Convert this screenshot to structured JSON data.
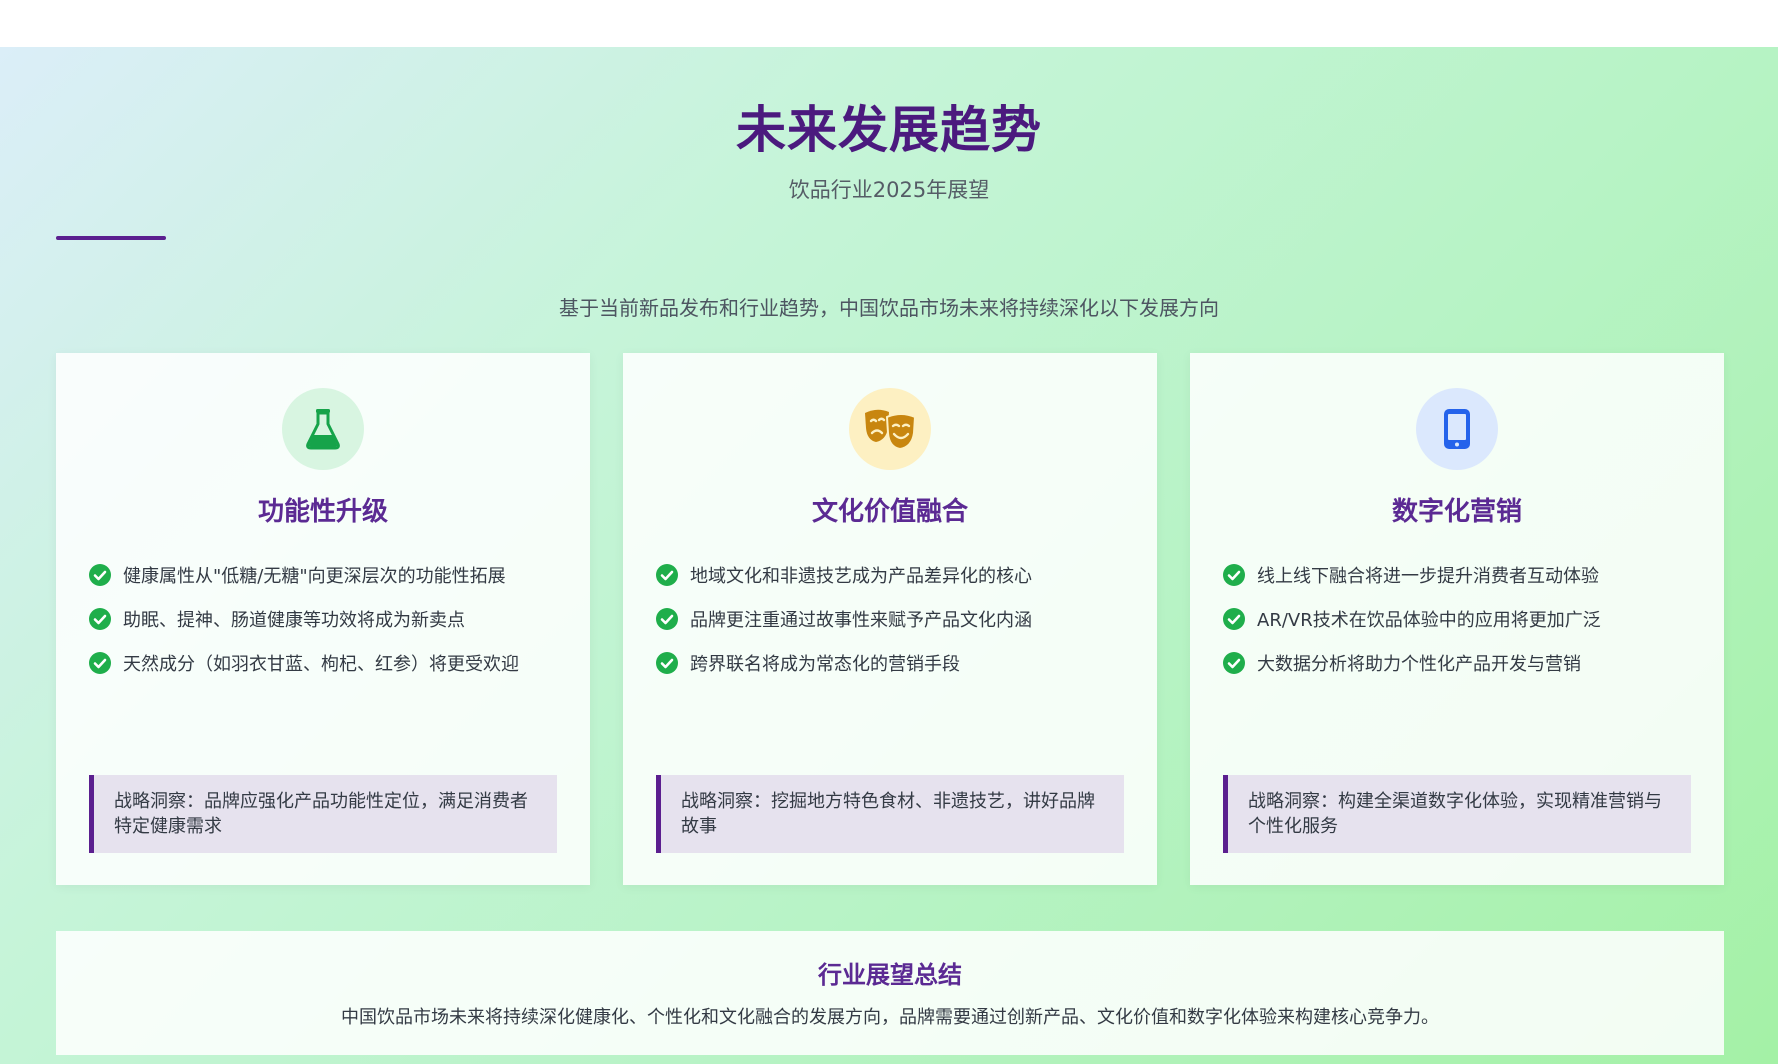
{
  "header": {
    "title": "未来发展趋势",
    "subtitle": "饮品行业2025年展望",
    "intro": "基于当前新品发布和行业趋势，中国饮品市场未来将持续深化以下发展方向"
  },
  "cards": [
    {
      "icon": "flask-icon",
      "icon_color": "#16a34a",
      "title": "功能性升级",
      "items": [
        "健康属性从\"低糖/无糖\"向更深层次的功能性拓展",
        "助眠、提神、肠道健康等功效将成为新卖点",
        "天然成分（如羽衣甘蓝、枸杞、红参）将更受欢迎"
      ],
      "insight": "战略洞察：品牌应强化产品功能性定位，满足消费者特定健康需求"
    },
    {
      "icon": "theater-masks-icon",
      "icon_color": "#c8860f",
      "title": "文化价值融合",
      "items": [
        "地域文化和非遗技艺成为产品差异化的核心",
        "品牌更注重通过故事性来赋予产品文化内涵",
        "跨界联名将成为常态化的营销手段"
      ],
      "insight": "战略洞察：挖掘地方特色食材、非遗技艺，讲好品牌故事"
    },
    {
      "icon": "mobile-phone-icon",
      "icon_color": "#2563eb",
      "title": "数字化营销",
      "items": [
        "线上线下融合将进一步提升消费者互动体验",
        "AR/VR技术在饮品体验中的应用将更加广泛",
        "大数据分析将助力个性化产品开发与营销"
      ],
      "insight": "战略洞察：构建全渠道数字化体验，实现精准营销与个性化服务"
    }
  ],
  "summary": {
    "title": "行业展望总结",
    "text": "中国饮品市场未来将持续深化健康化、个性化和文化融合的发展方向，品牌需要通过创新产品、文化价值和数字化体验来构建核心竞争力。"
  },
  "colors": {
    "accent": "#5b1f8f",
    "title": "#4b1a7e",
    "check": "#1fae4b"
  }
}
